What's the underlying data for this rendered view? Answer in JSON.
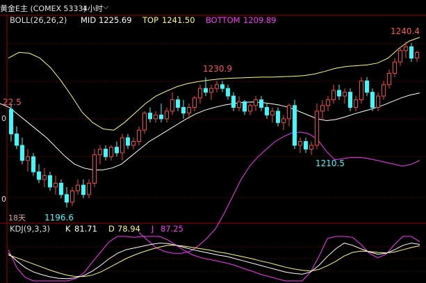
{
  "header": {
    "title": "黄金E主 (COMEX 5333)",
    "timeframe": "4小时",
    "timeframe_icon": "chevron-down-icon"
  },
  "boll": {
    "name": "BOLL(26,26,2)",
    "mid_label": "MID",
    "mid_value": "1225.69",
    "top_label": "TOP",
    "top_value": "1241.50",
    "bottom_label": "BOTTOM",
    "bottom_value": "1209.89",
    "colors": {
      "mid": "#ffffff",
      "top": "#ffff66",
      "bottom": "#ff33ff"
    }
  },
  "kdj": {
    "name": "KDJ(9,3,3)",
    "k_label": "K",
    "k_value": "81.71",
    "d_label": "D",
    "d_value": "78.94",
    "j_label": "J",
    "j_value": "87.25",
    "colors": {
      "k": "#ffffff",
      "d": "#ffff66",
      "j": "#ff33ff"
    }
  },
  "price_labels": {
    "left_partial": "22.5",
    "high_1": "1230.9",
    "high_2": "1240.4",
    "low_1": "1196.6",
    "low_2": "1210.5"
  },
  "axis_left_partial": {
    "upper": "0",
    "lower": "0"
  },
  "period_label": "18天",
  "colors": {
    "up": "#ff4444",
    "down": "#33ffff",
    "grid": "#8b0000",
    "text": "#dddddd"
  },
  "chart_data": {
    "type": "candlestick",
    "symbol": "COMEX 5333",
    "interval": "4小时",
    "candles_ohlc": [
      [
        1222.5,
        1224.0,
        1214.0,
        1216.0
      ],
      [
        1216.0,
        1218.0,
        1212.0,
        1213.0
      ],
      [
        1213.0,
        1215.0,
        1208.0,
        1209.0
      ],
      [
        1209.0,
        1212.0,
        1206.0,
        1210.0
      ],
      [
        1210.0,
        1211.0,
        1205.0,
        1206.0
      ],
      [
        1206.0,
        1208.0,
        1203.0,
        1204.0
      ],
      [
        1204.0,
        1207.0,
        1202.0,
        1205.0
      ],
      [
        1205.0,
        1206.0,
        1201.0,
        1202.0
      ],
      [
        1202.0,
        1205.0,
        1200.0,
        1203.0
      ],
      [
        1203.0,
        1204.0,
        1199.0,
        1200.0
      ],
      [
        1200.0,
        1202.0,
        1196.6,
        1198.0
      ],
      [
        1198.0,
        1202.0,
        1197.0,
        1201.0
      ],
      [
        1201.0,
        1204.0,
        1200.0,
        1202.5
      ],
      [
        1202.5,
        1204.0,
        1199.0,
        1200.0
      ],
      [
        1200.0,
        1204.0,
        1199.0,
        1203.0
      ],
      [
        1203.0,
        1212.0,
        1202.0,
        1210.5
      ],
      [
        1210.5,
        1213.0,
        1208.0,
        1212.0
      ],
      [
        1212.0,
        1213.0,
        1209.0,
        1210.0
      ],
      [
        1210.0,
        1213.0,
        1209.0,
        1212.5
      ],
      [
        1212.5,
        1214.0,
        1210.0,
        1211.0
      ],
      [
        1211.0,
        1216.0,
        1209.0,
        1215.0
      ],
      [
        1215.0,
        1216.0,
        1212.0,
        1213.0
      ],
      [
        1213.0,
        1215.0,
        1212.0,
        1214.0
      ],
      [
        1214.0,
        1218.0,
        1213.0,
        1217.0
      ],
      [
        1217.0,
        1222.0,
        1216.0,
        1221.5
      ],
      [
        1221.5,
        1223.0,
        1219.0,
        1220.0
      ],
      [
        1220.0,
        1222.0,
        1219.0,
        1221.0
      ],
      [
        1221.0,
        1224.0,
        1219.0,
        1220.0
      ],
      [
        1220.0,
        1223.0,
        1219.0,
        1222.0
      ],
      [
        1222.0,
        1227.0,
        1221.0,
        1225.0
      ],
      [
        1225.0,
        1226.0,
        1222.0,
        1223.0
      ],
      [
        1223.0,
        1225.0,
        1220.0,
        1221.5
      ],
      [
        1221.5,
        1224.0,
        1220.0,
        1223.0
      ],
      [
        1223.0,
        1226.0,
        1222.0,
        1225.5
      ],
      [
        1225.5,
        1229.0,
        1224.0,
        1228.0
      ],
      [
        1228.0,
        1230.9,
        1226.0,
        1227.0
      ],
      [
        1227.0,
        1229.0,
        1225.0,
        1228.0
      ],
      [
        1228.0,
        1230.0,
        1227.0,
        1229.0
      ],
      [
        1229.0,
        1230.0,
        1227.0,
        1228.0
      ],
      [
        1228.0,
        1229.0,
        1225.0,
        1226.0
      ],
      [
        1226.0,
        1227.0,
        1222.0,
        1223.0
      ],
      [
        1223.0,
        1226.0,
        1222.0,
        1224.5
      ],
      [
        1224.5,
        1225.0,
        1221.0,
        1222.0
      ],
      [
        1222.0,
        1224.0,
        1221.0,
        1223.5
      ],
      [
        1223.5,
        1226.0,
        1222.0,
        1225.0
      ],
      [
        1225.0,
        1226.0,
        1222.0,
        1223.0
      ],
      [
        1223.0,
        1224.0,
        1220.0,
        1221.0
      ],
      [
        1221.0,
        1223.0,
        1219.0,
        1222.0
      ],
      [
        1222.0,
        1223.0,
        1218.0,
        1219.0
      ],
      [
        1219.0,
        1221.0,
        1217.0,
        1220.0
      ],
      [
        1220.0,
        1224.0,
        1218.0,
        1223.5
      ],
      [
        1223.5,
        1225.0,
        1212.0,
        1213.0
      ],
      [
        1213.0,
        1215.0,
        1211.0,
        1214.0
      ],
      [
        1214.0,
        1215.0,
        1211.0,
        1212.0
      ],
      [
        1212.0,
        1214.0,
        1210.5,
        1213.0
      ],
      [
        1213.0,
        1224.0,
        1212.0,
        1222.0
      ],
      [
        1222.0,
        1225.0,
        1220.0,
        1223.5
      ],
      [
        1223.5,
        1226.0,
        1222.0,
        1225.0
      ],
      [
        1225.0,
        1229.0,
        1224.0,
        1227.5
      ],
      [
        1227.5,
        1229.0,
        1225.0,
        1226.0
      ],
      [
        1226.0,
        1228.0,
        1224.0,
        1227.0
      ],
      [
        1227.0,
        1228.0,
        1222.0,
        1223.0
      ],
      [
        1223.0,
        1226.0,
        1222.0,
        1225.0
      ],
      [
        1225.0,
        1231.0,
        1224.0,
        1230.0
      ],
      [
        1230.0,
        1231.0,
        1226.0,
        1227.0
      ],
      [
        1227.0,
        1228.0,
        1222.0,
        1223.0
      ],
      [
        1223.0,
        1227.0,
        1222.0,
        1226.0
      ],
      [
        1226.0,
        1230.0,
        1225.0,
        1229.0
      ],
      [
        1229.0,
        1233.0,
        1228.0,
        1232.0
      ],
      [
        1232.0,
        1236.0,
        1231.0,
        1235.0
      ],
      [
        1235.0,
        1239.0,
        1234.0,
        1238.0
      ],
      [
        1238.0,
        1240.4,
        1236.0,
        1239.0
      ],
      [
        1239.0,
        1240.0,
        1235.0,
        1236.0
      ],
      [
        1236.0,
        1238.0,
        1235.0,
        1237.5
      ]
    ],
    "boll_mid": [
      1224,
      1223,
      1221,
      1219,
      1217,
      1215,
      1212.5,
      1210,
      1208,
      1207,
      1206.5,
      1206.5,
      1207,
      1208,
      1210,
      1212,
      1214,
      1215.5,
      1217,
      1218.5,
      1220,
      1221.3,
      1222.3,
      1223,
      1223.6,
      1224,
      1224.3,
      1224.4,
      1224.3,
      1224,
      1223.6,
      1223,
      1222,
      1221,
      1220,
      1219.5,
      1219.8,
      1220.5,
      1221.3,
      1222,
      1222.7,
      1223.5,
      1224.5,
      1225.5,
      1226.3,
      1226.8
    ],
    "boll_top": [
      1236,
      1237.5,
      1237.3,
      1236,
      1233.5,
      1230,
      1226,
      1221.7,
      1219,
      1217.3,
      1217,
      1219,
      1221.5,
      1224,
      1226,
      1227.3,
      1228.5,
      1229.3,
      1229.8,
      1230.2,
      1230.5,
      1230.7,
      1230.8,
      1230.9,
      1231,
      1231,
      1231.1,
      1231.2,
      1231.4,
      1231.8,
      1232.5,
      1233.3,
      1233.8,
      1234,
      1234.2,
      1234.7,
      1236,
      1238.5,
      1240.5,
      1241.5
    ],
    "boll_bottom": [
      1190,
      1188,
      1186,
      1185,
      1184.5,
      1184.5,
      1185,
      1186.5,
      1188.5,
      1191,
      1195,
      1199.5,
      1204,
      1207.5,
      1210,
      1212,
      1214,
      1215.3,
      1216.3,
      1216.5,
      1216,
      1214.5,
      1211.5,
      1209.2,
      1209.5,
      1209.8,
      1209.8,
      1209.5,
      1209,
      1208.5,
      1208,
      1207.5,
      1208,
      1209
    ],
    "kdj_k": [
      62,
      45,
      30,
      20,
      14,
      9,
      6,
      5,
      7,
      12,
      22,
      35,
      50,
      62,
      70,
      74,
      78,
      82,
      85,
      84,
      80,
      75,
      70,
      66,
      62,
      58,
      55,
      50,
      45,
      40,
      35,
      30,
      25,
      20,
      17,
      15,
      20,
      35,
      55,
      72,
      85,
      80,
      72,
      65,
      60,
      62,
      70,
      80,
      85,
      82
    ],
    "kdj_d": [
      58,
      52,
      45,
      38,
      31,
      24,
      18,
      13,
      10,
      10,
      13,
      20,
      30,
      40,
      50,
      58,
      65,
      71,
      76,
      80,
      80,
      78,
      75,
      72,
      69,
      65,
      62,
      58,
      54,
      50,
      45,
      41,
      36,
      31,
      27,
      24,
      22,
      26,
      34,
      44,
      56,
      64,
      67,
      66,
      64,
      63,
      65,
      70,
      75,
      79
    ],
    "kdj_j": [
      70,
      30,
      8,
      0,
      0,
      0,
      0,
      0,
      5,
      18,
      42,
      65,
      88,
      100,
      100,
      98,
      100,
      100,
      100,
      92,
      80,
      68,
      58,
      52,
      48,
      44,
      40,
      35,
      28,
      22,
      15,
      10,
      5,
      0,
      0,
      0,
      20,
      55,
      95,
      100,
      100,
      98,
      82,
      62,
      52,
      60,
      82,
      100,
      100,
      88
    ],
    "extremes": {
      "high_1": "1230.9",
      "high_2": "1240.4",
      "low_1": "1196.6",
      "low_2": "1210.5"
    }
  }
}
